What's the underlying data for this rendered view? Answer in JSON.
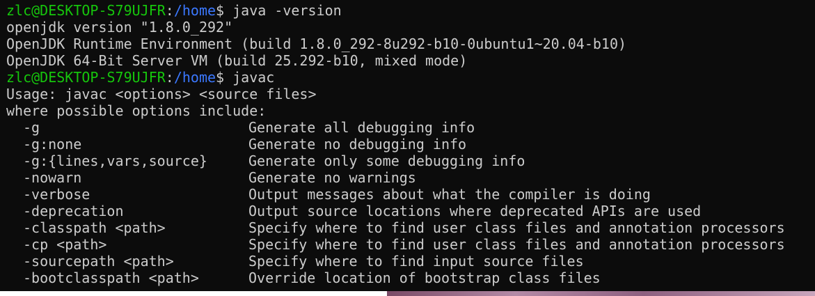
{
  "prompt1": {
    "user_host": "zlc@DESKTOP-S79UJFR",
    "sep": ":",
    "path": "/home",
    "suffix": "$ ",
    "command": "java -version"
  },
  "java_output": [
    "openjdk version \"1.8.0_292\"",
    "OpenJDK Runtime Environment (build 1.8.0_292-8u292-b10-0ubuntu1~20.04-b10)",
    "OpenJDK 64-Bit Server VM (build 25.292-b10, mixed mode)"
  ],
  "prompt2": {
    "user_host": "zlc@DESKTOP-S79UJFR",
    "sep": ":",
    "path": "/home",
    "suffix": "$ ",
    "command": "javac"
  },
  "javac_usage": "Usage: javac <options> <source files>",
  "javac_where": "where possible options include:",
  "options": [
    {
      "flag": "-g",
      "desc": "Generate all debugging info"
    },
    {
      "flag": "-g:none",
      "desc": "Generate no debugging info"
    },
    {
      "flag": "-g:{lines,vars,source}",
      "desc": "Generate only some debugging info"
    },
    {
      "flag": "-nowarn",
      "desc": "Generate no warnings"
    },
    {
      "flag": "-verbose",
      "desc": "Output messages about what the compiler is doing"
    },
    {
      "flag": "-deprecation",
      "desc": "Output source locations where deprecated APIs are used"
    },
    {
      "flag": "-classpath <path>",
      "desc": "Specify where to find user class files and annotation processors"
    },
    {
      "flag": "-cp <path>",
      "desc": "Specify where to find user class files and annotation processors"
    },
    {
      "flag": "-sourcepath <path>",
      "desc": "Specify where to find input source files"
    },
    {
      "flag": "-bootclasspath <path>",
      "desc": "Override location of bootstrap class files"
    }
  ],
  "colors": {
    "background": "#0c0c0c",
    "text": "#cccccc",
    "user_host": "#16c60c",
    "path": "#3b78ff"
  }
}
